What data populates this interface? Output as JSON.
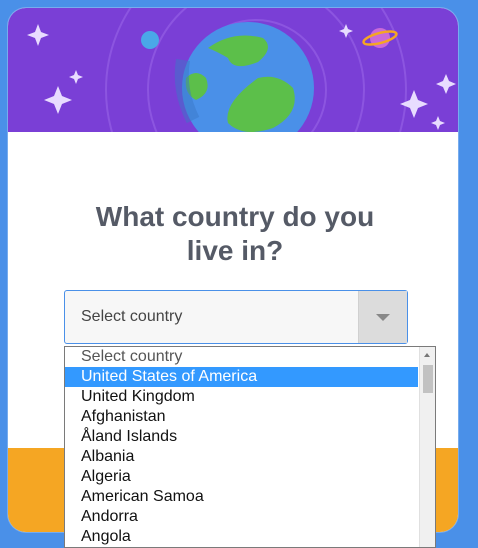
{
  "header": {
    "image_name": "space-earth-illustration",
    "colors": {
      "sky": "#7a3fd6",
      "ocean": "#4a90e8",
      "land": "#5cbf4a",
      "stars": "#e8dcff",
      "planet": "#c96ad9"
    }
  },
  "question": {
    "title": "What country do you live in?"
  },
  "country_select": {
    "selected_value": "Select country",
    "options": [
      "Select country",
      "United States of America",
      "United Kingdom",
      "Afghanistan",
      "Åland Islands",
      "Albania",
      "Algeria",
      "American Samoa",
      "Andorra",
      "Angola"
    ],
    "highlighted_option": "United States of America"
  },
  "footer": {
    "color": "#f5a623"
  }
}
